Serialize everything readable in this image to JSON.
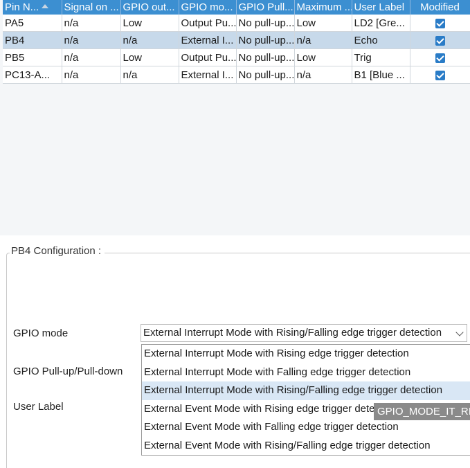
{
  "table": {
    "columns": [
      "Pin N...",
      "Signal on ...",
      "GPIO out...",
      "GPIO mo...",
      "GPIO Pull...",
      "Maximum ...",
      "User Label",
      "Modified"
    ],
    "rows": [
      {
        "pin": "PA5",
        "signal": "n/a",
        "output": "Low",
        "mode": "Output Pu...",
        "pull": "No pull-up...",
        "max": "Low",
        "label": "LD2 [Gre...",
        "modified": true
      },
      {
        "pin": "PB4",
        "signal": "n/a",
        "output": "n/a",
        "mode": "External I...",
        "pull": "No pull-up...",
        "max": "n/a",
        "label": "Echo",
        "modified": true
      },
      {
        "pin": "PB5",
        "signal": "n/a",
        "output": "Low",
        "mode": "Output Pu...",
        "pull": "No pull-up...",
        "max": "Low",
        "label": "Trig",
        "modified": true
      },
      {
        "pin": "PC13-A...",
        "signal": "n/a",
        "output": "n/a",
        "mode": "External I...",
        "pull": "No pull-up...",
        "max": "n/a",
        "label": "B1 [Blue ...",
        "modified": true
      }
    ],
    "selected_row": "PB4"
  },
  "config": {
    "title": "PB4 Configuration :",
    "gpio_mode_label": "GPIO mode",
    "pull_label": "GPIO Pull-up/Pull-down",
    "user_label_label": "User Label",
    "gpio_mode_value": "External Interrupt Mode with Rising/Falling edge trigger detection",
    "options": [
      "External Interrupt Mode with Rising edge trigger detection",
      "External Interrupt Mode with Falling edge trigger detection",
      "External Interrupt Mode with Rising/Falling edge trigger detection",
      "External Event Mode with Rising edge trigger detection",
      "External Event Mode with Falling edge trigger detection",
      "External Event Mode with Rising/Falling edge trigger detection"
    ],
    "tooltip": "GPIO_MODE_IT_RISING_FALLING"
  },
  "colors": {
    "header": "#3c8fd1",
    "selected_row": "#c7d9ea",
    "checkbox": "#2a7cc7"
  }
}
